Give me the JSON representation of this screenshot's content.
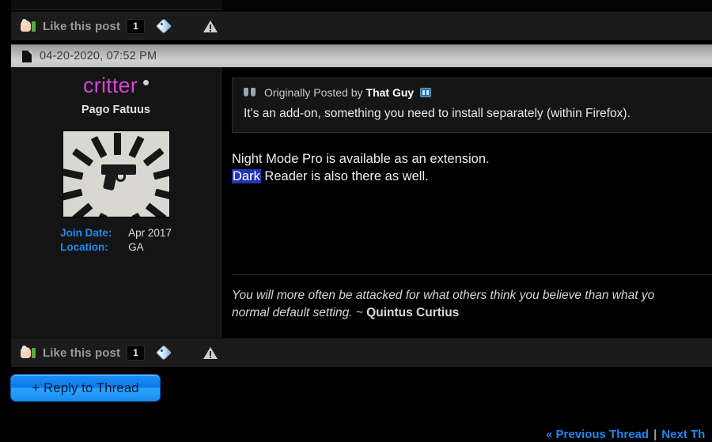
{
  "likebar": {
    "thumb_icon": "thumbs-up-icon",
    "label": "Like this post",
    "count": "1",
    "tag_icon": "tag-icon",
    "warn_icon": "report-warning-icon"
  },
  "datebar": {
    "post_icon": "post-page-icon",
    "date": "04-20-2020, 07:52 PM"
  },
  "user": {
    "name": "critter",
    "title": "Pago Fatuus",
    "avatar_alt": "pistol-and-magazines-avatar",
    "info": [
      {
        "label": "Join Date:",
        "value": "Apr 2017"
      },
      {
        "label": "Location:",
        "value": "GA"
      }
    ]
  },
  "quote": {
    "glyph": "quotation-marks-icon",
    "prefix": "Originally Posted by",
    "author": "That Guy",
    "view_icon": "view-post-icon",
    "text": "It's an add-on, something you need to install separately (within Firefox)."
  },
  "post": {
    "line1": "Night Mode Pro is available as an extension.",
    "highlighted": "Dark",
    "line2_rest": " Reader is also there as well."
  },
  "signature": {
    "line1": "You will more often be attacked for what others think you believe than what yo",
    "line2": "normal default setting. ~ ",
    "author": "Quintus Curtius"
  },
  "reply_button": {
    "label": "+ Reply to Thread"
  },
  "thread_nav": {
    "previous": "« Previous Thread",
    "separator": "|",
    "next": "Next Th"
  },
  "colors": {
    "username": "#d646d6",
    "link": "#1e86ef",
    "info_label": "#2288ee",
    "highlight": "#2234b8",
    "page_bg": "#000000",
    "panel_bg": "#141414"
  }
}
